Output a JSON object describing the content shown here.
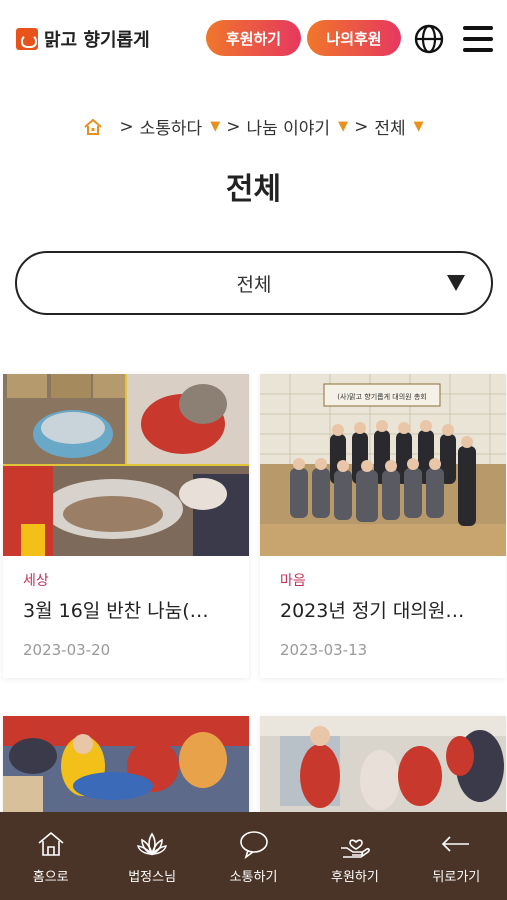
{
  "header": {
    "logo_text": "맑고 향기롭게",
    "support_button": "후원하기",
    "my_support_button": "나의후원"
  },
  "breadcrumb": {
    "items": [
      "소통하다",
      "나눔 이야기",
      "전체"
    ]
  },
  "page_title": "전체",
  "filter": {
    "selected": "전체"
  },
  "cards": [
    {
      "category": "세상",
      "title": "3월 16일 반찬 나눔(…",
      "date": "2023-03-20"
    },
    {
      "category": "마음",
      "title": "2023년 정기 대의원…",
      "date": "2023-03-13"
    },
    {
      "category": "",
      "title": "",
      "date": ""
    },
    {
      "category": "",
      "title": "",
      "date": ""
    }
  ],
  "photo_banner_text": "(사)맑고 향기롭게 대의원 총회",
  "bottom_nav": [
    {
      "label": "홈으로",
      "icon": "home-icon"
    },
    {
      "label": "법정스님",
      "icon": "lotus-icon"
    },
    {
      "label": "소통하기",
      "icon": "chat-bubble-icon"
    },
    {
      "label": "후원하기",
      "icon": "heart-hand-icon"
    },
    {
      "label": "뒤로가기",
      "icon": "back-arrow-icon"
    }
  ],
  "colors": {
    "accent_gradient_start": "#f0772a",
    "accent_gradient_end": "#e6385f",
    "breadcrumb_triangle": "#e8901d",
    "category": "#c3325a",
    "bottom_nav_bg": "#4a3427"
  }
}
